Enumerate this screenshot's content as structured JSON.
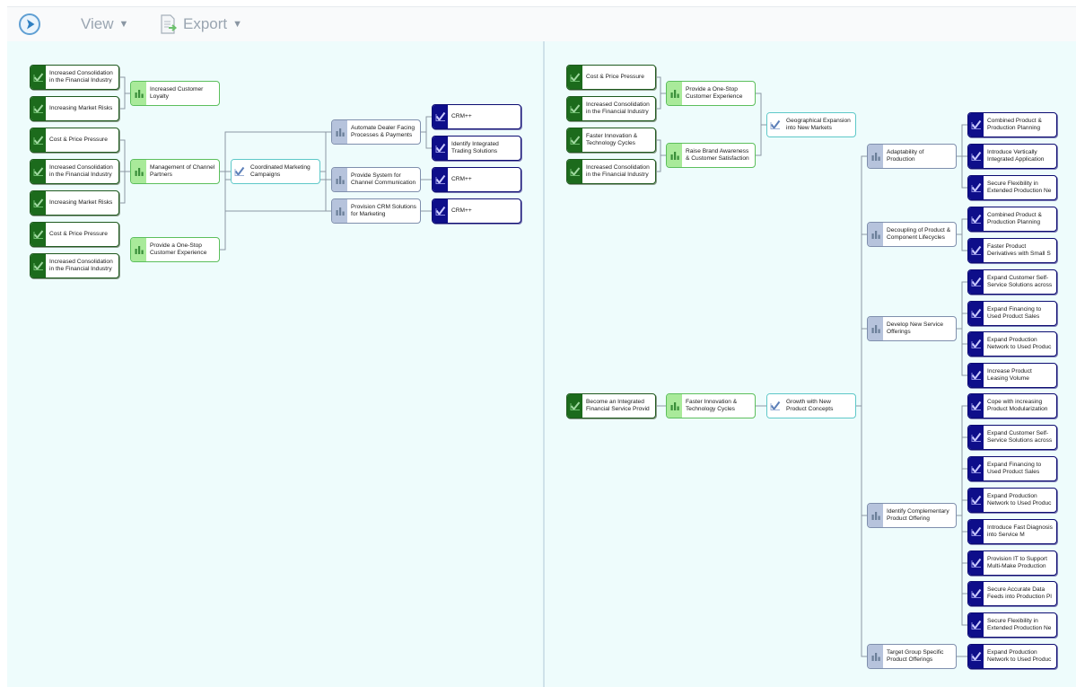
{
  "toolbar": {
    "logo_icon": "play-circle-icon",
    "view_label": "View",
    "export_label": "Export",
    "export_icon": "export-document-icon"
  },
  "colors": {
    "driver": "#1c6b1c",
    "objective": "#a9ea9a",
    "strategy": "#5ec8c8",
    "capability": "#b6c3dc",
    "initiative": "#0e0e8a",
    "pane_background": "#eefcfc"
  },
  "left": {
    "drivers": [
      "Increased Consolidation in the Financial Industry",
      "Increasing Market Risks",
      "Cost & Price Pressure",
      "Increased Consolidation in the Financial Industry",
      "Increasing Market Risks",
      "Cost & Price Pressure",
      "Increased Consolidation in the Financial Industry"
    ],
    "objectives": [
      "Increased Customer Loyalty",
      "Management of Channel Partners",
      "Provide a One-Stop Customer Experience"
    ],
    "strategy": "Coordinated Marketing Campaigns",
    "capabilities": [
      "Automate Dealer Facing Processes & Payments",
      "Provide System for Channel Communication",
      "Provision CRM Solutions for Marketing"
    ],
    "initiatives": [
      "CRM++",
      "Identify Integrated Trading Solutions",
      "CRM++",
      "CRM++"
    ]
  },
  "right": {
    "drivers": [
      "Cost & Price Pressure",
      "Increased Consolidation in the Financial Industry",
      "Faster Innovation & Technology Cycles",
      "Increased Consolidation in the Financial Industry",
      "Become an Integrated Financial Service Provid"
    ],
    "objectives": [
      "Provide a One-Stop Customer Experience",
      "Raise Brand Awareness & Customer Satisfaction",
      "Faster Innovation & Technology Cycles"
    ],
    "strategies": [
      "Geographical Expansion into New Markets",
      "Growth with New Product Concepts"
    ],
    "capabilities": [
      "Adaptability of Production",
      "Decoupling of Product & Component Lifecycles",
      "Develop New Service Offerings",
      "Identify Complementary Product Offering",
      "Target Group Specific Product Offerings"
    ],
    "initiatives": [
      "Combined Product & Production Planning",
      "Introduce Vertically Integrated Application",
      "Secure Flexibility in Extended Production Ne",
      "Combined Product & Production Planning",
      "Faster Product Derivatives with Small S",
      "Expand Customer Self-Service Solutions across",
      "Expand Financing to Used Product Sales",
      "Expand Production Network to Used Produc",
      "Increase Product Leasing Volume",
      "Cope with increasing Product Modularization",
      "Expand Customer Self-Service Solutions across",
      "Expand Financing to Used Product Sales",
      "Expand Production Network to Used Produc",
      "Introduce Fast Diagnosis into Service M",
      "Provision IT to Support Multi-Make Production",
      "Secure Accurate Data Feeds into Production Pl",
      "Secure Flexibility in Extended Production Ne",
      "Expand Production Network to Used Produc"
    ]
  }
}
